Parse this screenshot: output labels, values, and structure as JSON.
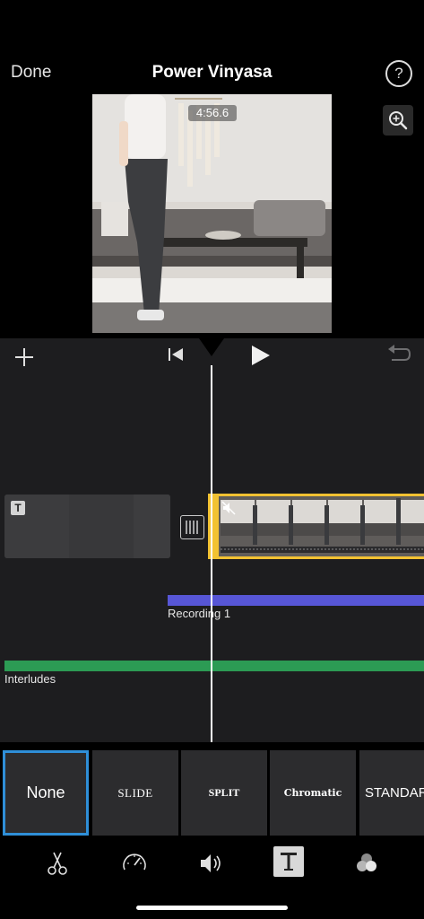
{
  "header": {
    "done_label": "Done",
    "title": "Power Vinyasa",
    "help_label": "?"
  },
  "viewer": {
    "timecode": "4:56.6"
  },
  "timeline": {
    "recording_label": "Recording 1",
    "interludes_label": "Interludes",
    "title_clip_badge": "T"
  },
  "title_styles": [
    {
      "label": "None",
      "selected": true
    },
    {
      "label": "SLIDE"
    },
    {
      "label": "SPLIT"
    },
    {
      "label": "Chromatic"
    },
    {
      "label": "STANDARD"
    }
  ],
  "toolbar": {
    "tools": [
      "scissors-icon",
      "speed-icon",
      "volume-icon",
      "title-icon",
      "filter-icon"
    ],
    "active_tool": "title-icon"
  },
  "colors": {
    "clip_selection": "#f2c232",
    "recording_track": "#5756d6",
    "interludes_track": "#2c9b54",
    "selected_style_border": "#2f8fd8"
  }
}
